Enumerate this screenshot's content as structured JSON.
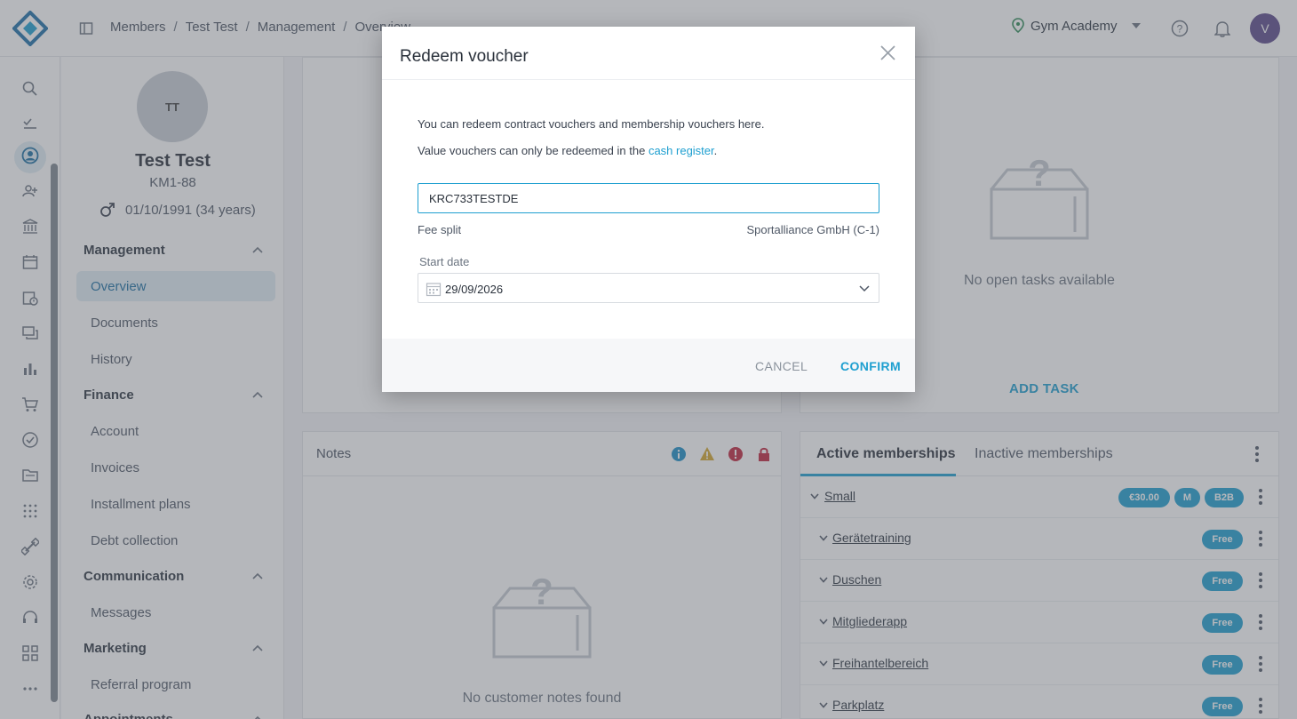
{
  "header": {
    "breadcrumb": [
      "Members",
      "Test Test",
      "Management",
      "Overview"
    ],
    "gym_name": "Gym Academy",
    "user_initial": "V"
  },
  "member": {
    "initials": "TT",
    "name": "Test Test",
    "number": "KM1-88",
    "dob": "01/10/1991 (34 years)"
  },
  "nav": {
    "management": "Management",
    "overview": "Overview",
    "documents": "Documents",
    "history": "History",
    "finance": "Finance",
    "account": "Account",
    "invoices": "Invoices",
    "installment_plans": "Installment plans",
    "debt_collection": "Debt collection",
    "communication": "Communication",
    "messages": "Messages",
    "marketing": "Marketing",
    "referral_program": "Referral program",
    "appointments": "Appointments"
  },
  "tasks": {
    "empty_text": "No open tasks available",
    "add_task": "ADD TASK"
  },
  "notes": {
    "title": "Notes",
    "empty_text": "No customer notes found"
  },
  "memberships": {
    "tab_active": "Active memberships",
    "tab_inactive": "Inactive memberships",
    "rows": [
      {
        "label": "Small",
        "badges": [
          "€30.00",
          "M",
          "B2B"
        ]
      },
      {
        "label": "Gerätetraining",
        "badges": [
          "Free"
        ]
      },
      {
        "label": "Duschen",
        "badges": [
          "Free"
        ]
      },
      {
        "label": "Mitgliederapp",
        "badges": [
          "Free"
        ]
      },
      {
        "label": "Freihantelbereich",
        "badges": [
          "Free"
        ]
      },
      {
        "label": "Parkplatz",
        "badges": [
          "Free"
        ]
      }
    ]
  },
  "modal": {
    "title": "Redeem voucher",
    "text1": "You can redeem contract vouchers and membership vouchers here.",
    "text2_prefix": "Value vouchers can only be redeemed in the ",
    "text2_link": "cash register",
    "text2_suffix": ".",
    "voucher_value": "KRC733TESTDE",
    "fee_split_label": "Fee split",
    "fee_split_value": "Sportalliance GmbH (C-1)",
    "start_date_label": "Start date",
    "start_date_value": "29/09/2026",
    "cancel": "CANCEL",
    "confirm": "CONFIRM"
  },
  "colors": {
    "accent": "#1e9fd0",
    "overlay": "#5a6068"
  }
}
